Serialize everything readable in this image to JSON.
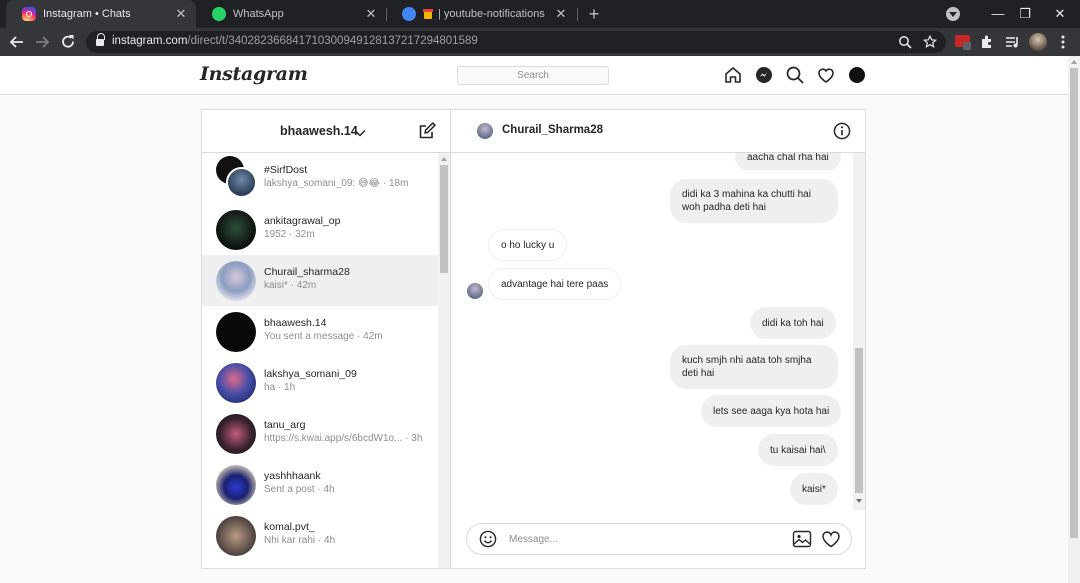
{
  "browser": {
    "tabs": [
      {
        "title": "Instagram • Chats",
        "active": true
      },
      {
        "title": "WhatsApp",
        "active": false
      },
      {
        "title": "| youtube-notifications",
        "active": false
      }
    ],
    "url_host": "instagram.com",
    "url_path": "/direct/t/340282366841710300949128137217294801589"
  },
  "header": {
    "logo": "Instagram",
    "search_placeholder": "Search"
  },
  "inbox": {
    "account": "bhaawesh.14",
    "threads": [
      {
        "name": "#SirfDost",
        "sub": "lakshya_somani_09: 😅😂 · 18m"
      },
      {
        "name": "ankitagrawal_op",
        "sub": "1952 · 32m"
      },
      {
        "name": "Churail_sharma28",
        "sub": "kaisi* · 42m"
      },
      {
        "name": "bhaawesh.14",
        "sub": "You sent a message · 42m"
      },
      {
        "name": "lakshya_somani_09",
        "sub": "ha · 1h"
      },
      {
        "name": "tanu_arg",
        "sub": "https://s.kwai.app/s/6bcdW1o... · 3h"
      },
      {
        "name": "yashhhaank",
        "sub": "Sent a post · 4h"
      },
      {
        "name": "komal.pvt_",
        "sub": "Nhi kar rahi · 4h"
      }
    ]
  },
  "chat": {
    "name": "Churail_Sharma28",
    "messages": [
      {
        "text": "aacha chal rha hai",
        "from": "me"
      },
      {
        "text": "didi ka 3 mahina ka chutti hai woh padha deti hai",
        "from": "me"
      },
      {
        "text": "o ho lucky u",
        "from": "them"
      },
      {
        "text": "advantage hai tere paas",
        "from": "them"
      },
      {
        "text": "didi ka toh hai",
        "from": "me"
      },
      {
        "text": "kuch smjh nhi aata toh smjha deti hai",
        "from": "me"
      },
      {
        "text": "lets see aaga kya hota hai",
        "from": "me"
      },
      {
        "text": "tu kaisai hai\\",
        "from": "me"
      },
      {
        "text": "kaisi*",
        "from": "me"
      }
    ],
    "composer_placeholder": "Message..."
  }
}
